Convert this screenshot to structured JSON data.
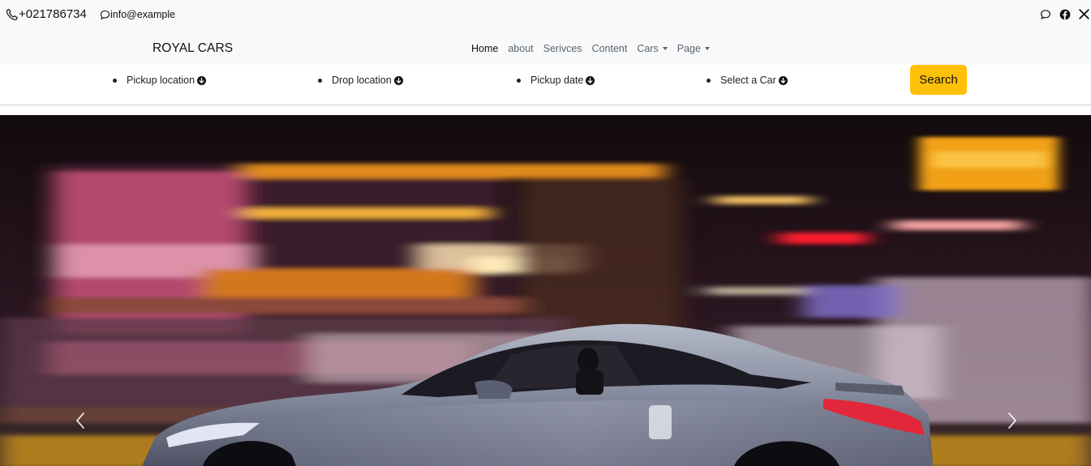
{
  "topbar": {
    "phone": "+021786734",
    "email": "info@example",
    "icons": [
      "phone-icon",
      "chat-icon",
      "message-icon",
      "facebook-icon",
      "x-icon"
    ]
  },
  "navbar": {
    "brand": "ROYAL CARS",
    "links": [
      {
        "label": "Home",
        "active": true,
        "dropdown": false
      },
      {
        "label": "about",
        "active": false,
        "dropdown": false
      },
      {
        "label": "Serivces",
        "active": false,
        "dropdown": false
      },
      {
        "label": "Content",
        "active": false,
        "dropdown": false
      },
      {
        "label": "Cars",
        "active": false,
        "dropdown": true
      },
      {
        "label": "Page",
        "active": false,
        "dropdown": true
      }
    ]
  },
  "search": {
    "filters": [
      {
        "label": "Pickup location",
        "icon": "arrow-down-circle-icon"
      },
      {
        "label": "Drop location",
        "icon": "arrow-down-circle-icon"
      },
      {
        "label": "Pickup date",
        "icon": "arrow-down-circle-icon"
      },
      {
        "label": "Select a Car",
        "icon": "arrow-down-circle-icon"
      }
    ],
    "button_label": "Search"
  },
  "hero": {
    "image": "night-sports-car-motion-blur",
    "controls": [
      "chevron-left-icon",
      "chevron-right-icon"
    ]
  },
  "colors": {
    "accent": "#ffc107",
    "bar_bg": "#f8f9fa"
  }
}
